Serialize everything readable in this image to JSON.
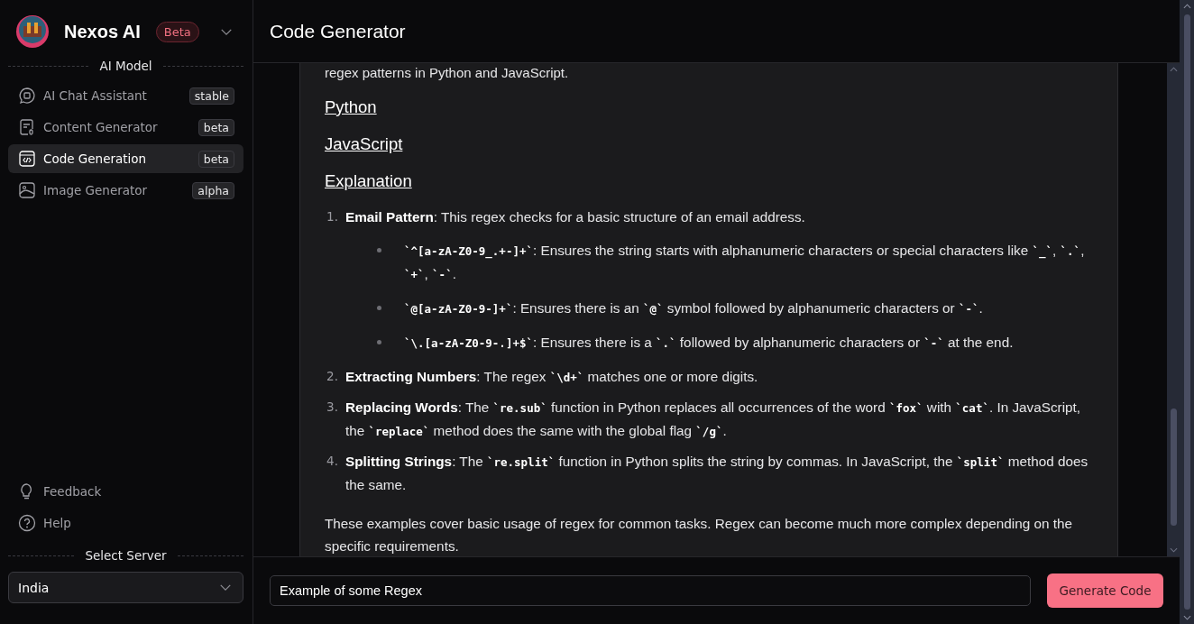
{
  "brand": {
    "name": "Nexos AI",
    "badge": "Beta"
  },
  "model_section": {
    "title": "AI Model",
    "items": [
      {
        "label": "AI Chat Assistant",
        "tag": "stable",
        "selected": false
      },
      {
        "label": "Content Generator",
        "tag": "beta",
        "selected": false
      },
      {
        "label": "Code Generation",
        "tag": "beta",
        "selected": true
      },
      {
        "label": "Image Generator",
        "tag": "alpha",
        "selected": false
      }
    ]
  },
  "footer_links": [
    {
      "label": "Feedback"
    },
    {
      "label": "Help"
    }
  ],
  "server": {
    "title": "Select Server",
    "value": "India"
  },
  "header": {
    "title": "Code Generator"
  },
  "content": {
    "intro": "regex patterns in Python and JavaScript.",
    "headings": [
      "Python",
      "JavaScript",
      "Explanation"
    ],
    "list": [
      {
        "number": "1.",
        "parts": [
          {
            "kind": "bold",
            "text": "Email Pattern"
          },
          {
            "kind": "plain",
            "text": ": This regex checks for a basic structure of an email address."
          }
        ],
        "bullets": [
          [
            {
              "kind": "code",
              "text": "`^[a-zA-Z0-9_.+-]+`"
            },
            {
              "kind": "plain",
              "text": ": Ensures the string starts with alphanumeric characters or special characters like "
            },
            {
              "kind": "code",
              "text": "`_`"
            },
            {
              "kind": "plain",
              "text": ", "
            },
            {
              "kind": "code",
              "text": "`.`"
            },
            {
              "kind": "plain",
              "text": ", "
            },
            {
              "kind": "code",
              "text": "`+`"
            },
            {
              "kind": "plain",
              "text": ", "
            },
            {
              "kind": "code",
              "text": "`-`"
            },
            {
              "kind": "plain",
              "text": "."
            }
          ],
          [
            {
              "kind": "code",
              "text": "`@[a-zA-Z0-9-]+`"
            },
            {
              "kind": "plain",
              "text": ": Ensures there is an "
            },
            {
              "kind": "code",
              "text": "`@`"
            },
            {
              "kind": "plain",
              "text": " symbol followed by alphanumeric characters or "
            },
            {
              "kind": "code",
              "text": "`-`"
            },
            {
              "kind": "plain",
              "text": "."
            }
          ],
          [
            {
              "kind": "code",
              "text": "`\\.[a-zA-Z0-9-.]+$`"
            },
            {
              "kind": "plain",
              "text": ": Ensures there is a "
            },
            {
              "kind": "code",
              "text": "`.`"
            },
            {
              "kind": "plain",
              "text": " followed by alphanumeric characters or "
            },
            {
              "kind": "code",
              "text": "`-`"
            },
            {
              "kind": "plain",
              "text": " at the end."
            }
          ]
        ]
      },
      {
        "number": "2.",
        "parts": [
          {
            "kind": "bold",
            "text": "Extracting Numbers"
          },
          {
            "kind": "plain",
            "text": ": The regex "
          },
          {
            "kind": "code",
            "text": "`\\d+`"
          },
          {
            "kind": "plain",
            "text": " matches one or more digits."
          }
        ]
      },
      {
        "number": "3.",
        "parts": [
          {
            "kind": "bold",
            "text": "Replacing Words"
          },
          {
            "kind": "plain",
            "text": ": The "
          },
          {
            "kind": "code",
            "text": "`re.sub`"
          },
          {
            "kind": "plain",
            "text": " function in Python replaces all occurrences of the word "
          },
          {
            "kind": "code",
            "text": "`fox`"
          },
          {
            "kind": "plain",
            "text": " with "
          },
          {
            "kind": "code",
            "text": "`cat`"
          },
          {
            "kind": "plain",
            "text": ". In JavaScript, the "
          },
          {
            "kind": "code",
            "text": "`replace`"
          },
          {
            "kind": "plain",
            "text": " method does the same with the global flag "
          },
          {
            "kind": "code",
            "text": "`/g`"
          },
          {
            "kind": "plain",
            "text": "."
          }
        ]
      },
      {
        "number": "4.",
        "parts": [
          {
            "kind": "bold",
            "text": "Splitting Strings"
          },
          {
            "kind": "plain",
            "text": ": The "
          },
          {
            "kind": "code",
            "text": "`re.split`"
          },
          {
            "kind": "plain",
            "text": " function in Python splits the string by commas. In JavaScript, the "
          },
          {
            "kind": "code",
            "text": "`split`"
          },
          {
            "kind": "plain",
            "text": " method does the same."
          }
        ]
      }
    ],
    "outro": "These examples cover basic usage of regex for common tasks. Regex can become much more complex depending on the specific requirements."
  },
  "prompt": {
    "value": "Example of some Regex"
  },
  "generate_button": "Generate Code"
}
